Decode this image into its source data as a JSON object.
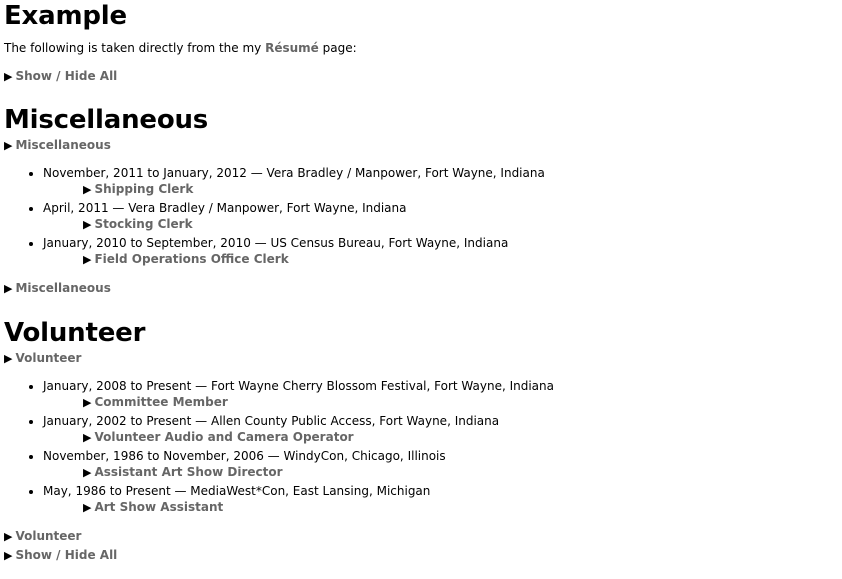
{
  "header": {
    "title": "Example",
    "intro_prefix": "The following is taken directly from the my ",
    "intro_link": "Résumé",
    "intro_suffix": " page:",
    "show_hide_all": "Show / Hide All"
  },
  "arrow": "▶",
  "misc": {
    "heading": "Miscellaneous",
    "toggle_label": "Miscellaneous",
    "items": [
      {
        "text": "November, 2011 to January, 2012 — Vera Bradley / Manpower, Fort Wayne, Indiana",
        "role": "Shipping Clerk"
      },
      {
        "text": "April, 2011 — Vera Bradley / Manpower, Fort Wayne, Indiana",
        "role": "Stocking Clerk"
      },
      {
        "text": "January, 2010 to September, 2010 — US Census Bureau, Fort Wayne, Indiana",
        "role": "Field Operations Office Clerk"
      }
    ]
  },
  "volunteer": {
    "heading": "Volunteer",
    "toggle_label": "Volunteer",
    "items": [
      {
        "text": "January, 2008 to Present — Fort Wayne Cherry Blossom Festival, Fort Wayne, Indiana",
        "role": "Committee Member"
      },
      {
        "text": "January, 2002 to Present — Allen County Public Access, Fort Wayne, Indiana",
        "role": "Volunteer Audio and Camera Operator"
      },
      {
        "text": "November, 1986 to November, 2006 — WindyCon, Chicago, Illinois",
        "role": "Assistant Art Show Director"
      },
      {
        "text": "May, 1986 to Present — MediaWest*Con, East Lansing, Michigan",
        "role": "Art Show Assistant"
      }
    ]
  }
}
